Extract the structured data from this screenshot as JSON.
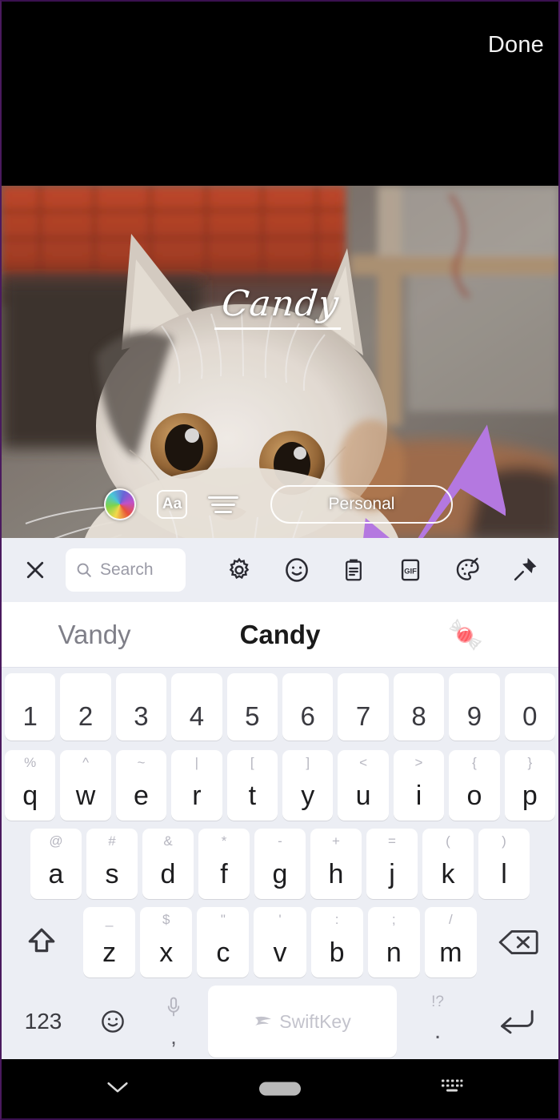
{
  "header": {
    "done_label": "Done"
  },
  "story_editor": {
    "overlay_text": "Candy",
    "toolbar": {
      "color_wheel_name": "color-wheel-icon",
      "font_label": "Aa",
      "align_name": "text-align-icon",
      "privacy_label": "Personal"
    },
    "annotation": {
      "arrow_color": "#b478e0",
      "arrow_name": "purple-annotation-arrow"
    },
    "photo_alt": "close-up of a fluffy white cat in front of orange roof tiles"
  },
  "keyboard": {
    "toolbar": {
      "close_label": "×",
      "search_placeholder": "Search",
      "items": [
        {
          "name": "close-icon",
          "label": "close"
        },
        {
          "name": "search-input",
          "label": "Search"
        },
        {
          "name": "gear-icon",
          "label": "settings"
        },
        {
          "name": "smiley-icon",
          "label": "emoji"
        },
        {
          "name": "clipboard-icon",
          "label": "clipboard"
        },
        {
          "name": "gif-icon",
          "label": "GIF"
        },
        {
          "name": "palette-icon",
          "label": "stickers"
        },
        {
          "name": "pin-icon",
          "label": "pin"
        }
      ],
      "gif_label": "GIF"
    },
    "predictions": [
      {
        "text": "Vandy",
        "state": "normal"
      },
      {
        "text": "Candy",
        "state": "selected"
      },
      {
        "text": "🍬",
        "state": "emoji"
      }
    ],
    "rows": {
      "numbers": [
        {
          "main": "1"
        },
        {
          "main": "2"
        },
        {
          "main": "3"
        },
        {
          "main": "4"
        },
        {
          "main": "5"
        },
        {
          "main": "6"
        },
        {
          "main": "7"
        },
        {
          "main": "8"
        },
        {
          "main": "9"
        },
        {
          "main": "0"
        }
      ],
      "top": [
        {
          "main": "q",
          "alt": "%"
        },
        {
          "main": "w",
          "alt": "^"
        },
        {
          "main": "e",
          "alt": "~"
        },
        {
          "main": "r",
          "alt": "|"
        },
        {
          "main": "t",
          "alt": "["
        },
        {
          "main": "y",
          "alt": "]"
        },
        {
          "main": "u",
          "alt": "<"
        },
        {
          "main": "i",
          "alt": ">"
        },
        {
          "main": "o",
          "alt": "{"
        },
        {
          "main": "p",
          "alt": "}"
        }
      ],
      "home": [
        {
          "main": "a",
          "alt": "@"
        },
        {
          "main": "s",
          "alt": "#"
        },
        {
          "main": "d",
          "alt": "&"
        },
        {
          "main": "f",
          "alt": "*"
        },
        {
          "main": "g",
          "alt": "-"
        },
        {
          "main": "h",
          "alt": "+"
        },
        {
          "main": "j",
          "alt": "="
        },
        {
          "main": "k",
          "alt": "("
        },
        {
          "main": "l",
          "alt": ")"
        }
      ],
      "bottom": [
        {
          "main": "z",
          "alt": "_"
        },
        {
          "main": "x",
          "alt": "$"
        },
        {
          "main": "c",
          "alt": "\""
        },
        {
          "main": "v",
          "alt": "'"
        },
        {
          "main": "b",
          "alt": ":"
        },
        {
          "main": "n",
          "alt": ";"
        },
        {
          "main": "m",
          "alt": "/"
        }
      ],
      "shift_name": "shift-icon",
      "backspace_name": "backspace-icon"
    },
    "bottom_row": {
      "numeric_label": "123",
      "emoji_name": "emoji-icon",
      "mic_name": "microphone-icon",
      "comma_label": ",",
      "space_brand": "SwiftKey",
      "period_alt": "!?",
      "period_label": ".",
      "enter_name": "enter-icon"
    }
  },
  "navbar": {
    "hide_keyboard_name": "chevron-down-icon",
    "home_name": "home-pill",
    "keyboard_switch_name": "keyboard-switch-icon"
  },
  "colors": {
    "accent_purple": "#b478e0",
    "keyboard_bg": "#eceef4",
    "key_bg": "#ffffff",
    "bezel": "#4a1a5e"
  }
}
